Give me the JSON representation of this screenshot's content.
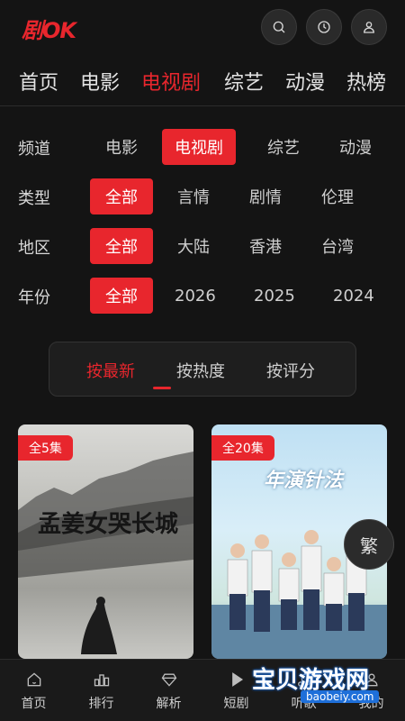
{
  "header": {
    "logo": "剧OK",
    "icons": [
      "search-icon",
      "history-icon",
      "user-icon"
    ]
  },
  "nav_tabs": [
    {
      "label": "首页",
      "active": false
    },
    {
      "label": "电影",
      "active": false
    },
    {
      "label": "电视剧",
      "active": true
    },
    {
      "label": "综艺",
      "active": false
    },
    {
      "label": "动漫",
      "active": false
    },
    {
      "label": "热榜",
      "active": false
    }
  ],
  "filters": {
    "channel": {
      "label": "频道",
      "options": [
        "电影",
        "电视剧",
        "综艺",
        "动漫"
      ],
      "selected": "电视剧"
    },
    "genre": {
      "label": "类型",
      "options": [
        "全部",
        "言情",
        "剧情",
        "伦理"
      ],
      "selected": "全部"
    },
    "region": {
      "label": "地区",
      "options": [
        "全部",
        "大陆",
        "香港",
        "台湾"
      ],
      "selected": "全部"
    },
    "year": {
      "label": "年份",
      "options": [
        "全部",
        "2026",
        "2025",
        "2024"
      ],
      "selected": "全部"
    }
  },
  "sort": {
    "options": [
      "按最新",
      "按热度",
      "按评分"
    ],
    "selected": "按最新"
  },
  "cards": [
    {
      "badge": "全5集",
      "poster_title": "孟姜女哭长城"
    },
    {
      "badge": "全20集",
      "poster_title": "年演针法"
    }
  ],
  "float_button": "繁",
  "bottom_nav": [
    {
      "label": "首页",
      "icon": "home-icon"
    },
    {
      "label": "排行",
      "icon": "ranking-icon"
    },
    {
      "label": "解析",
      "icon": "diamond-icon"
    },
    {
      "label": "短剧",
      "icon": "play-icon"
    },
    {
      "label": "听歌",
      "icon": "music-icon"
    },
    {
      "label": "我的",
      "icon": "user-icon"
    }
  ],
  "watermark": {
    "text": "宝贝游戏网",
    "url": "baobeiy.com"
  },
  "colors": {
    "accent": "#e8262d",
    "background": "#141414"
  }
}
